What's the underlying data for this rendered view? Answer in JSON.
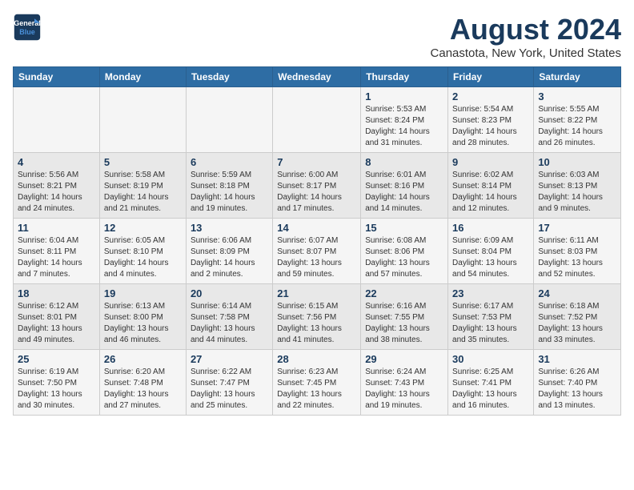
{
  "header": {
    "logo_line1": "General",
    "logo_line2": "Blue",
    "month_year": "August 2024",
    "location": "Canastota, New York, United States"
  },
  "weekdays": [
    "Sunday",
    "Monday",
    "Tuesday",
    "Wednesday",
    "Thursday",
    "Friday",
    "Saturday"
  ],
  "weeks": [
    [
      {
        "day": "",
        "info": ""
      },
      {
        "day": "",
        "info": ""
      },
      {
        "day": "",
        "info": ""
      },
      {
        "day": "",
        "info": ""
      },
      {
        "day": "1",
        "info": "Sunrise: 5:53 AM\nSunset: 8:24 PM\nDaylight: 14 hours\nand 31 minutes."
      },
      {
        "day": "2",
        "info": "Sunrise: 5:54 AM\nSunset: 8:23 PM\nDaylight: 14 hours\nand 28 minutes."
      },
      {
        "day": "3",
        "info": "Sunrise: 5:55 AM\nSunset: 8:22 PM\nDaylight: 14 hours\nand 26 minutes."
      }
    ],
    [
      {
        "day": "4",
        "info": "Sunrise: 5:56 AM\nSunset: 8:21 PM\nDaylight: 14 hours\nand 24 minutes."
      },
      {
        "day": "5",
        "info": "Sunrise: 5:58 AM\nSunset: 8:19 PM\nDaylight: 14 hours\nand 21 minutes."
      },
      {
        "day": "6",
        "info": "Sunrise: 5:59 AM\nSunset: 8:18 PM\nDaylight: 14 hours\nand 19 minutes."
      },
      {
        "day": "7",
        "info": "Sunrise: 6:00 AM\nSunset: 8:17 PM\nDaylight: 14 hours\nand 17 minutes."
      },
      {
        "day": "8",
        "info": "Sunrise: 6:01 AM\nSunset: 8:16 PM\nDaylight: 14 hours\nand 14 minutes."
      },
      {
        "day": "9",
        "info": "Sunrise: 6:02 AM\nSunset: 8:14 PM\nDaylight: 14 hours\nand 12 minutes."
      },
      {
        "day": "10",
        "info": "Sunrise: 6:03 AM\nSunset: 8:13 PM\nDaylight: 14 hours\nand 9 minutes."
      }
    ],
    [
      {
        "day": "11",
        "info": "Sunrise: 6:04 AM\nSunset: 8:11 PM\nDaylight: 14 hours\nand 7 minutes."
      },
      {
        "day": "12",
        "info": "Sunrise: 6:05 AM\nSunset: 8:10 PM\nDaylight: 14 hours\nand 4 minutes."
      },
      {
        "day": "13",
        "info": "Sunrise: 6:06 AM\nSunset: 8:09 PM\nDaylight: 14 hours\nand 2 minutes."
      },
      {
        "day": "14",
        "info": "Sunrise: 6:07 AM\nSunset: 8:07 PM\nDaylight: 13 hours\nand 59 minutes."
      },
      {
        "day": "15",
        "info": "Sunrise: 6:08 AM\nSunset: 8:06 PM\nDaylight: 13 hours\nand 57 minutes."
      },
      {
        "day": "16",
        "info": "Sunrise: 6:09 AM\nSunset: 8:04 PM\nDaylight: 13 hours\nand 54 minutes."
      },
      {
        "day": "17",
        "info": "Sunrise: 6:11 AM\nSunset: 8:03 PM\nDaylight: 13 hours\nand 52 minutes."
      }
    ],
    [
      {
        "day": "18",
        "info": "Sunrise: 6:12 AM\nSunset: 8:01 PM\nDaylight: 13 hours\nand 49 minutes."
      },
      {
        "day": "19",
        "info": "Sunrise: 6:13 AM\nSunset: 8:00 PM\nDaylight: 13 hours\nand 46 minutes."
      },
      {
        "day": "20",
        "info": "Sunrise: 6:14 AM\nSunset: 7:58 PM\nDaylight: 13 hours\nand 44 minutes."
      },
      {
        "day": "21",
        "info": "Sunrise: 6:15 AM\nSunset: 7:56 PM\nDaylight: 13 hours\nand 41 minutes."
      },
      {
        "day": "22",
        "info": "Sunrise: 6:16 AM\nSunset: 7:55 PM\nDaylight: 13 hours\nand 38 minutes."
      },
      {
        "day": "23",
        "info": "Sunrise: 6:17 AM\nSunset: 7:53 PM\nDaylight: 13 hours\nand 35 minutes."
      },
      {
        "day": "24",
        "info": "Sunrise: 6:18 AM\nSunset: 7:52 PM\nDaylight: 13 hours\nand 33 minutes."
      }
    ],
    [
      {
        "day": "25",
        "info": "Sunrise: 6:19 AM\nSunset: 7:50 PM\nDaylight: 13 hours\nand 30 minutes."
      },
      {
        "day": "26",
        "info": "Sunrise: 6:20 AM\nSunset: 7:48 PM\nDaylight: 13 hours\nand 27 minutes."
      },
      {
        "day": "27",
        "info": "Sunrise: 6:22 AM\nSunset: 7:47 PM\nDaylight: 13 hours\nand 25 minutes."
      },
      {
        "day": "28",
        "info": "Sunrise: 6:23 AM\nSunset: 7:45 PM\nDaylight: 13 hours\nand 22 minutes."
      },
      {
        "day": "29",
        "info": "Sunrise: 6:24 AM\nSunset: 7:43 PM\nDaylight: 13 hours\nand 19 minutes."
      },
      {
        "day": "30",
        "info": "Sunrise: 6:25 AM\nSunset: 7:41 PM\nDaylight: 13 hours\nand 16 minutes."
      },
      {
        "day": "31",
        "info": "Sunrise: 6:26 AM\nSunset: 7:40 PM\nDaylight: 13 hours\nand 13 minutes."
      }
    ]
  ]
}
